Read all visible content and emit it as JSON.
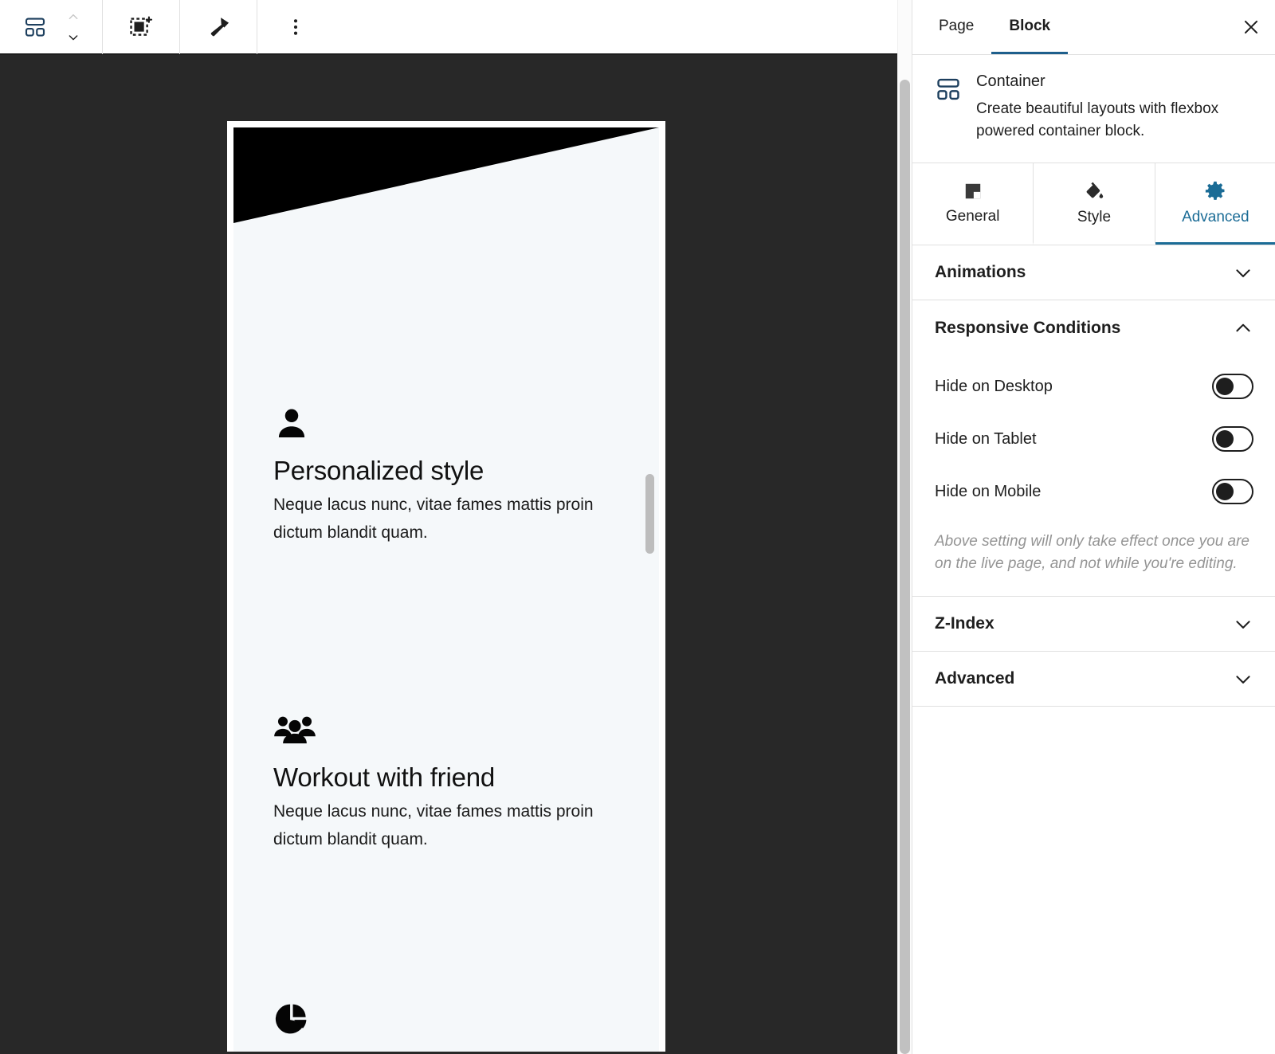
{
  "toolbar": {
    "block_type_icon": "container-block-icon",
    "move_up_label": "Move up",
    "move_down_label": "Move down",
    "select_parent_label": "Select parent block",
    "styles_label": "Styles",
    "options_label": "Options"
  },
  "canvas": {
    "background_color": "#282828",
    "preview_background": "#f5f8fa",
    "hero_color": "#000000",
    "features": [
      {
        "icon": "person-icon",
        "title": "Personalized style",
        "description": "Neque lacus nunc, vitae fames mattis proin dictum blandit quam."
      },
      {
        "icon": "people-group-icon",
        "title": "Workout with friend",
        "description": "Neque lacus nunc, vitae fames mattis proin dictum blandit quam."
      },
      {
        "icon": "pie-chart-icon",
        "title": "",
        "description": ""
      }
    ]
  },
  "sidebar": {
    "tabs": [
      {
        "label": "Page",
        "active": false
      },
      {
        "label": "Block",
        "active": true
      }
    ],
    "close_label": "Close settings",
    "block": {
      "icon": "container-block-icon",
      "title": "Container",
      "description": "Create beautiful layouts with flexbox powered container block."
    },
    "setting_tabs": [
      {
        "label": "General",
        "icon": "general-square-icon",
        "active": false
      },
      {
        "label": "Style",
        "icon": "paint-bucket-icon",
        "active": false
      },
      {
        "label": "Advanced",
        "icon": "gear-icon",
        "active": true
      }
    ],
    "panels": [
      {
        "title": "Animations",
        "expanded": false
      },
      {
        "title": "Responsive Conditions",
        "expanded": true
      },
      {
        "title": "Z-Index",
        "expanded": false
      },
      {
        "title": "Advanced",
        "expanded": false
      }
    ],
    "responsive": {
      "toggles": [
        {
          "label": "Hide on Desktop",
          "on": false
        },
        {
          "label": "Hide on Tablet",
          "on": false
        },
        {
          "label": "Hide on Mobile",
          "on": false
        }
      ],
      "note": "Above setting will only take effect once you are on the live page, and not while you're editing."
    }
  },
  "colors": {
    "accent": "#1b6c96",
    "canvas_bg": "#282828",
    "panel_border": "#e0e0e0",
    "muted_text": "#949494"
  }
}
